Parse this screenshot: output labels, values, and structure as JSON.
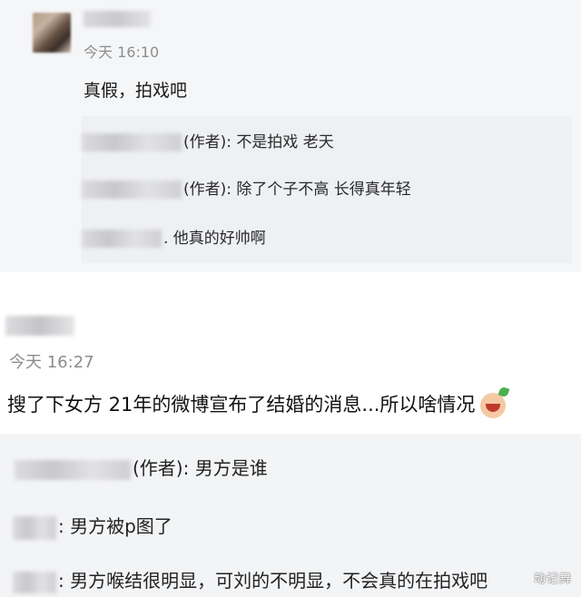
{
  "comment1": {
    "time": "今天 16:10",
    "text": "真假，拍戏吧",
    "replies": [
      {
        "author_tag": "(作者)",
        "text": ": 不是拍戏 老天"
      },
      {
        "author_tag": "(作者)",
        "text": ": 除了个子不高 长得真年轻"
      },
      {
        "author_tag": "",
        "text": ". 他真的好帅啊"
      }
    ]
  },
  "comment2": {
    "time": "今天 16:27",
    "text": "搜了下女方 21年的微博宣布了结婚的消息...所以啥情况",
    "emoji": "laughing-crying-emoji",
    "replies": [
      {
        "author_tag": "(作者)",
        "text": ": 男方是谁"
      },
      {
        "author_tag": "",
        "text": ": 男方被p图了"
      },
      {
        "author_tag": "",
        "text": ": 男方喉结很明显，可刘的不明显，不会真的在拍戏吧"
      }
    ]
  },
  "watermark": "动记舞"
}
